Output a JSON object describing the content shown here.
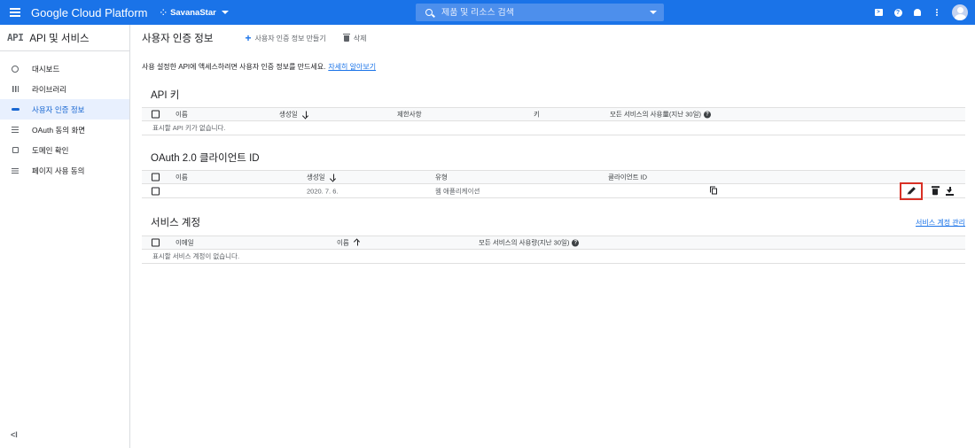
{
  "topbar": {
    "brand": "Google Cloud Platform",
    "project": "SavanaStar",
    "search_placeholder": "제품 및 리소스 검색"
  },
  "sidebar": {
    "logo": "API",
    "title": "API 및 서비스",
    "items": [
      {
        "label": "대시보드",
        "icon": "dashboard-icon"
      },
      {
        "label": "라이브러리",
        "icon": "library-icon"
      },
      {
        "label": "사용자 인증 정보",
        "icon": "key-icon",
        "active": true
      },
      {
        "label": "OAuth 동의 화면",
        "icon": "oauth-consent-icon"
      },
      {
        "label": "도메인 확인",
        "icon": "domain-verify-icon"
      },
      {
        "label": "페이지 사용 동의",
        "icon": "page-usage-icon"
      }
    ],
    "collapse": "<I"
  },
  "main": {
    "title": "사용자 인증 정보",
    "create_label": "사용자 인증 정보 만들기",
    "delete_label": "삭제",
    "intro_text": "사용 설정한 API에 액세스하려면 사용자 인증 정보를 만드세요.",
    "intro_link": "자세히 알아보기"
  },
  "api_keys": {
    "title": "API 키",
    "headers": {
      "name": "이름",
      "created": "생성일",
      "restrictions": "제한사항",
      "key": "키",
      "usage": "모든 서비스의 사용量(지난 30일)"
    },
    "empty": "표시할 API 키가 없습니다."
  },
  "oauth": {
    "title": "OAuth 2.0 클라이언트 ID",
    "headers": {
      "name": "이름",
      "created": "생성일",
      "type": "유형",
      "client_id": "클라이언트 ID"
    },
    "rows": [
      {
        "name": "",
        "created": "2020. 7. 6.",
        "type": "웹 애플리케이션",
        "client_id": ""
      }
    ]
  },
  "service_accounts": {
    "title": "서비스 계정",
    "manage_link": "서비스 계정 관리",
    "headers": {
      "email": "이메일",
      "name": "이름",
      "usage": "모든 서비스의 사용량(지난 30일)"
    },
    "empty": "표시할 서비스 계정이 없습니다."
  },
  "colors": {
    "accent": "#1a73e8",
    "highlight": "#d93025"
  }
}
